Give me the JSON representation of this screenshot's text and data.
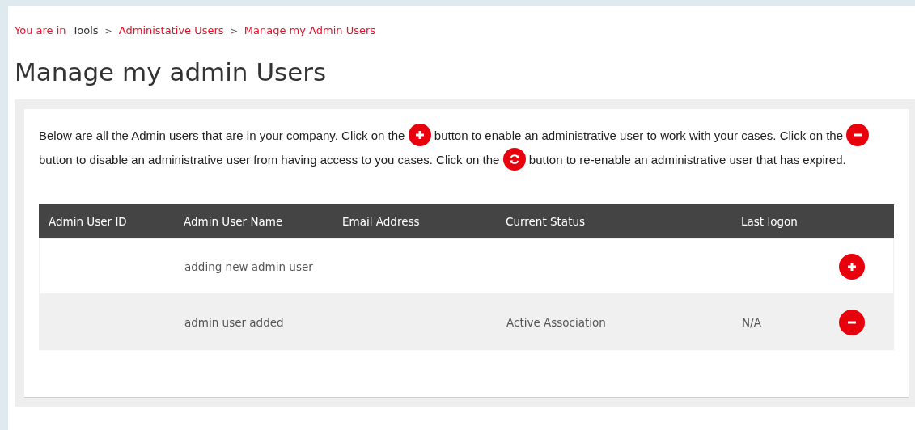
{
  "breadcrumb": {
    "prefix": "You are in",
    "items": [
      {
        "label": "Tools",
        "kind": "plain"
      },
      {
        "label": "Administative Users",
        "kind": "link"
      },
      {
        "label": "Manage my Admin Users",
        "kind": "link"
      }
    ],
    "separators": [
      ">",
      ">"
    ]
  },
  "title": "Manage my admin Users",
  "intro": [
    {
      "kind": "text",
      "text": "Below are all the Admin users that are in your company. Click on the "
    },
    {
      "kind": "add"
    },
    {
      "kind": "text",
      "text": " button to enable an administrative user to work with your cases. Click on the "
    },
    {
      "kind": "remove"
    },
    {
      "kind": "text",
      "text": " button to disable an administrative user from having access to you cases. Click on the "
    },
    {
      "kind": "renew"
    },
    {
      "kind": "text",
      "text": " button to re-enable an administrative user that has expired."
    }
  ],
  "table": {
    "columns": [
      "Admin User ID",
      "Admin User Name",
      "Email Address",
      "Current Status",
      "Last logon"
    ],
    "rows": [
      {
        "cells": [
          "",
          "adding new admin user",
          "",
          "",
          ""
        ],
        "kind": "add"
      },
      {
        "cells": [
          "",
          "admin user added",
          "",
          "Active Association",
          "N/A"
        ],
        "kind": "remove"
      }
    ]
  }
}
